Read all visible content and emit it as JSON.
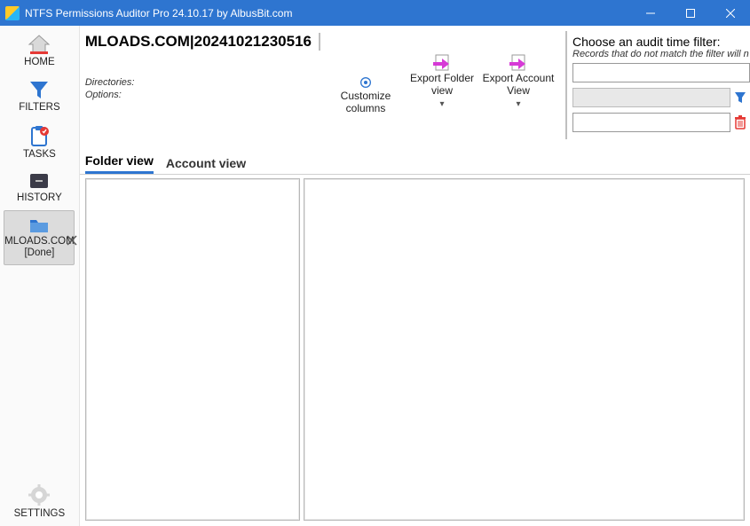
{
  "window": {
    "title": "NTFS Permissions Auditor Pro 24.10.17 by AlbusBit.com"
  },
  "sidebar": {
    "items": [
      {
        "label": "HOME",
        "icon": "home-icon"
      },
      {
        "label": "FILTERS",
        "icon": "funnel-icon"
      },
      {
        "label": "TASKS",
        "icon": "clipboard-icon"
      },
      {
        "label": "HISTORY",
        "icon": "drawer-icon"
      },
      {
        "label": "MLOADS.COM [Done]",
        "icon": "folder-icon",
        "active": true
      }
    ],
    "settings_label": "SETTINGS"
  },
  "scan": {
    "title": "MLOADS.COM|20241021230516",
    "directories_label": "Directories:",
    "options_label": "Options:"
  },
  "toolbar": {
    "customize_label": "Customize columns",
    "export_folder_label": "Export Folder view",
    "export_account_label": "Export Account View"
  },
  "filter": {
    "title": "Choose an audit time filter:",
    "subtitle": "Records that do not match the filter will n",
    "input1": "",
    "input2": "",
    "input3": ""
  },
  "tabs": {
    "folder": "Folder view",
    "account": "Account view",
    "active": "folder"
  },
  "colors": {
    "titlebar": "#2E75D0",
    "accent": "#2E75D0",
    "magenta": "#D63AD6",
    "danger": "#E53935"
  }
}
